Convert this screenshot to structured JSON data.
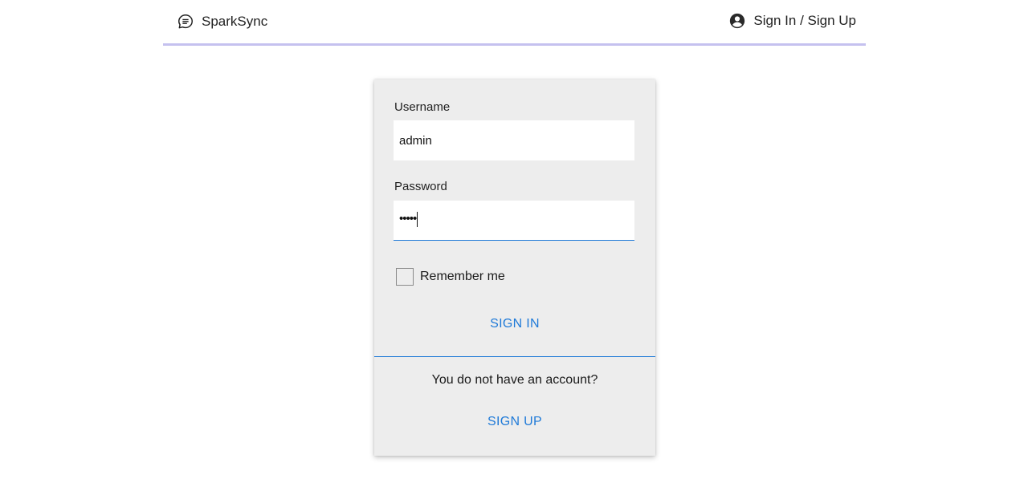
{
  "header": {
    "brand_name": "SparkSync",
    "brand_icon": "chat-bubble-icon",
    "auth_link_label": "Sign In / Sign Up",
    "auth_icon": "account-circle-icon",
    "accent_color": "#c5c1ef"
  },
  "login_form": {
    "username": {
      "label": "Username",
      "value": "admin"
    },
    "password": {
      "label": "Password",
      "masked_value": "•••••"
    },
    "remember_me": {
      "label": "Remember me",
      "checked": false
    },
    "sign_in_label": "SIGN IN",
    "no_account_text": "You do not have an account?",
    "sign_up_label": "SIGN UP",
    "link_color": "#1f7ad8"
  }
}
